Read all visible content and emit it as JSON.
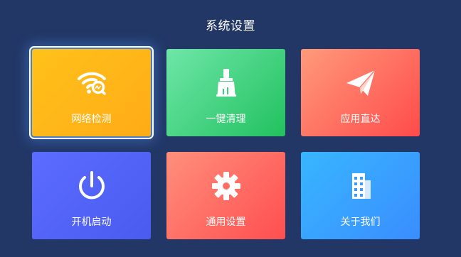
{
  "header": {
    "title": "系统设置"
  },
  "tiles": [
    {
      "label": "网络检测",
      "icon": "wifi-search-icon",
      "selected": true,
      "color_start": "#ffc21a",
      "color_end": "#ffab17"
    },
    {
      "label": "一键清理",
      "icon": "broom-icon",
      "selected": false,
      "color_start": "#6ee6a8",
      "color_end": "#22c15f"
    },
    {
      "label": "应用直达",
      "icon": "paper-plane-icon",
      "selected": false,
      "color_start": "#ff9a7a",
      "color_end": "#ff4b4b"
    },
    {
      "label": "开机启动",
      "icon": "power-icon",
      "selected": false,
      "color_start": "#5b6cff",
      "color_end": "#4a5bf0"
    },
    {
      "label": "通用设置",
      "icon": "gear-icon",
      "selected": false,
      "color_start": "#ff8f7a",
      "color_end": "#ff4e50"
    },
    {
      "label": "关于我们",
      "icon": "building-icon",
      "selected": false,
      "color_start": "#38b6ff",
      "color_end": "#3a8dff"
    }
  ],
  "colors": {
    "background": "#223766",
    "selection_glow": "#5aa0ff"
  }
}
